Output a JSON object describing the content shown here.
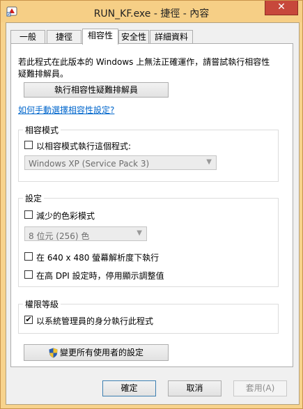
{
  "window": {
    "title": "RUN_KF.exe - 捷徑 - 內容",
    "close_label": "✕"
  },
  "tabs": [
    {
      "label": "一般"
    },
    {
      "label": "捷徑"
    },
    {
      "label": "相容性",
      "active": true
    },
    {
      "label": "安全性"
    },
    {
      "label": "詳細資料"
    }
  ],
  "compat": {
    "intro_line1": "若此程式在此版本的 Windows 上無法正確運作，請嘗試執行相容性",
    "intro_line2": "疑難排解員。",
    "troubleshooter_button": "執行相容性疑難排解員",
    "manual_link": "如何手動選擇相容性設定?"
  },
  "compat_mode": {
    "group_label": "相容模式",
    "checkbox_label": "以相容模式執行這個程式:",
    "checked": false,
    "os_select": "Windows XP (Service Pack 3)"
  },
  "settings": {
    "group_label": "設定",
    "reduced_color_label": "減少的色彩模式",
    "reduced_color_checked": false,
    "color_select": "8 位元 (256) 色",
    "resolution_label": "在 640 x 480 螢幕解析度下執行",
    "resolution_checked": false,
    "dpi_label": "在高 DPI 設定時，停用顯示調整值",
    "dpi_checked": false
  },
  "privilege": {
    "group_label": "權限等級",
    "admin_label": "以系統管理員的身分執行此程式",
    "admin_checked": true,
    "check_glyph": "✔"
  },
  "all_users_button": "變更所有使用者的設定",
  "footer": {
    "ok": "確定",
    "cancel": "取消",
    "apply": "套用(A)"
  },
  "icons": {
    "shield": "uac-shield-icon",
    "app": "app-shortcut-icon",
    "dropdown": "chevron-down-icon"
  }
}
